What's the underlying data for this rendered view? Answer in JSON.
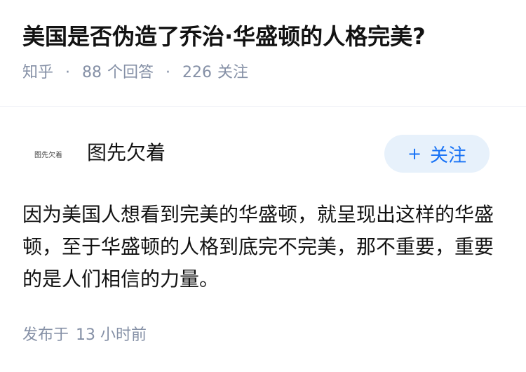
{
  "question": {
    "title": "美国是否伪造了乔治·华盛顿的人格完美?",
    "source": "知乎",
    "answer_count": "88",
    "answer_label": "个回答",
    "follower_count": "226",
    "follower_label": "关注",
    "separator": "·"
  },
  "answer": {
    "author": {
      "avatar_text": "图先欠着",
      "name": "图先欠着"
    },
    "follow_button": {
      "icon": "plus-icon",
      "icon_glyph": "+",
      "label": "关注"
    },
    "content": "因为美国人想看到完美的华盛顿，就呈现出这样的华盛顿，至于华盛顿的人格到底完不完美，那不重要，重要的是人们相信的力量。",
    "time_label": "发布于",
    "time_value": "13 小时前"
  },
  "colors": {
    "title": "#121212",
    "meta": "#8590a6",
    "follow_bg": "#e7f1fb",
    "follow_text": "#1772f6"
  }
}
